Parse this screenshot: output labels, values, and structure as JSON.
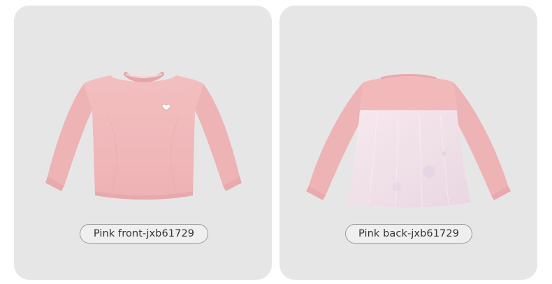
{
  "cards": [
    {
      "caption": "Pink front-jxb61729",
      "view": "front"
    },
    {
      "caption": "Pink back-jxb61729",
      "view": "back"
    }
  ],
  "colors": {
    "card_background": "#e7e6e7",
    "shirt_pink": "#f2b9ba",
    "mesh_panel": "#efe1e6"
  }
}
